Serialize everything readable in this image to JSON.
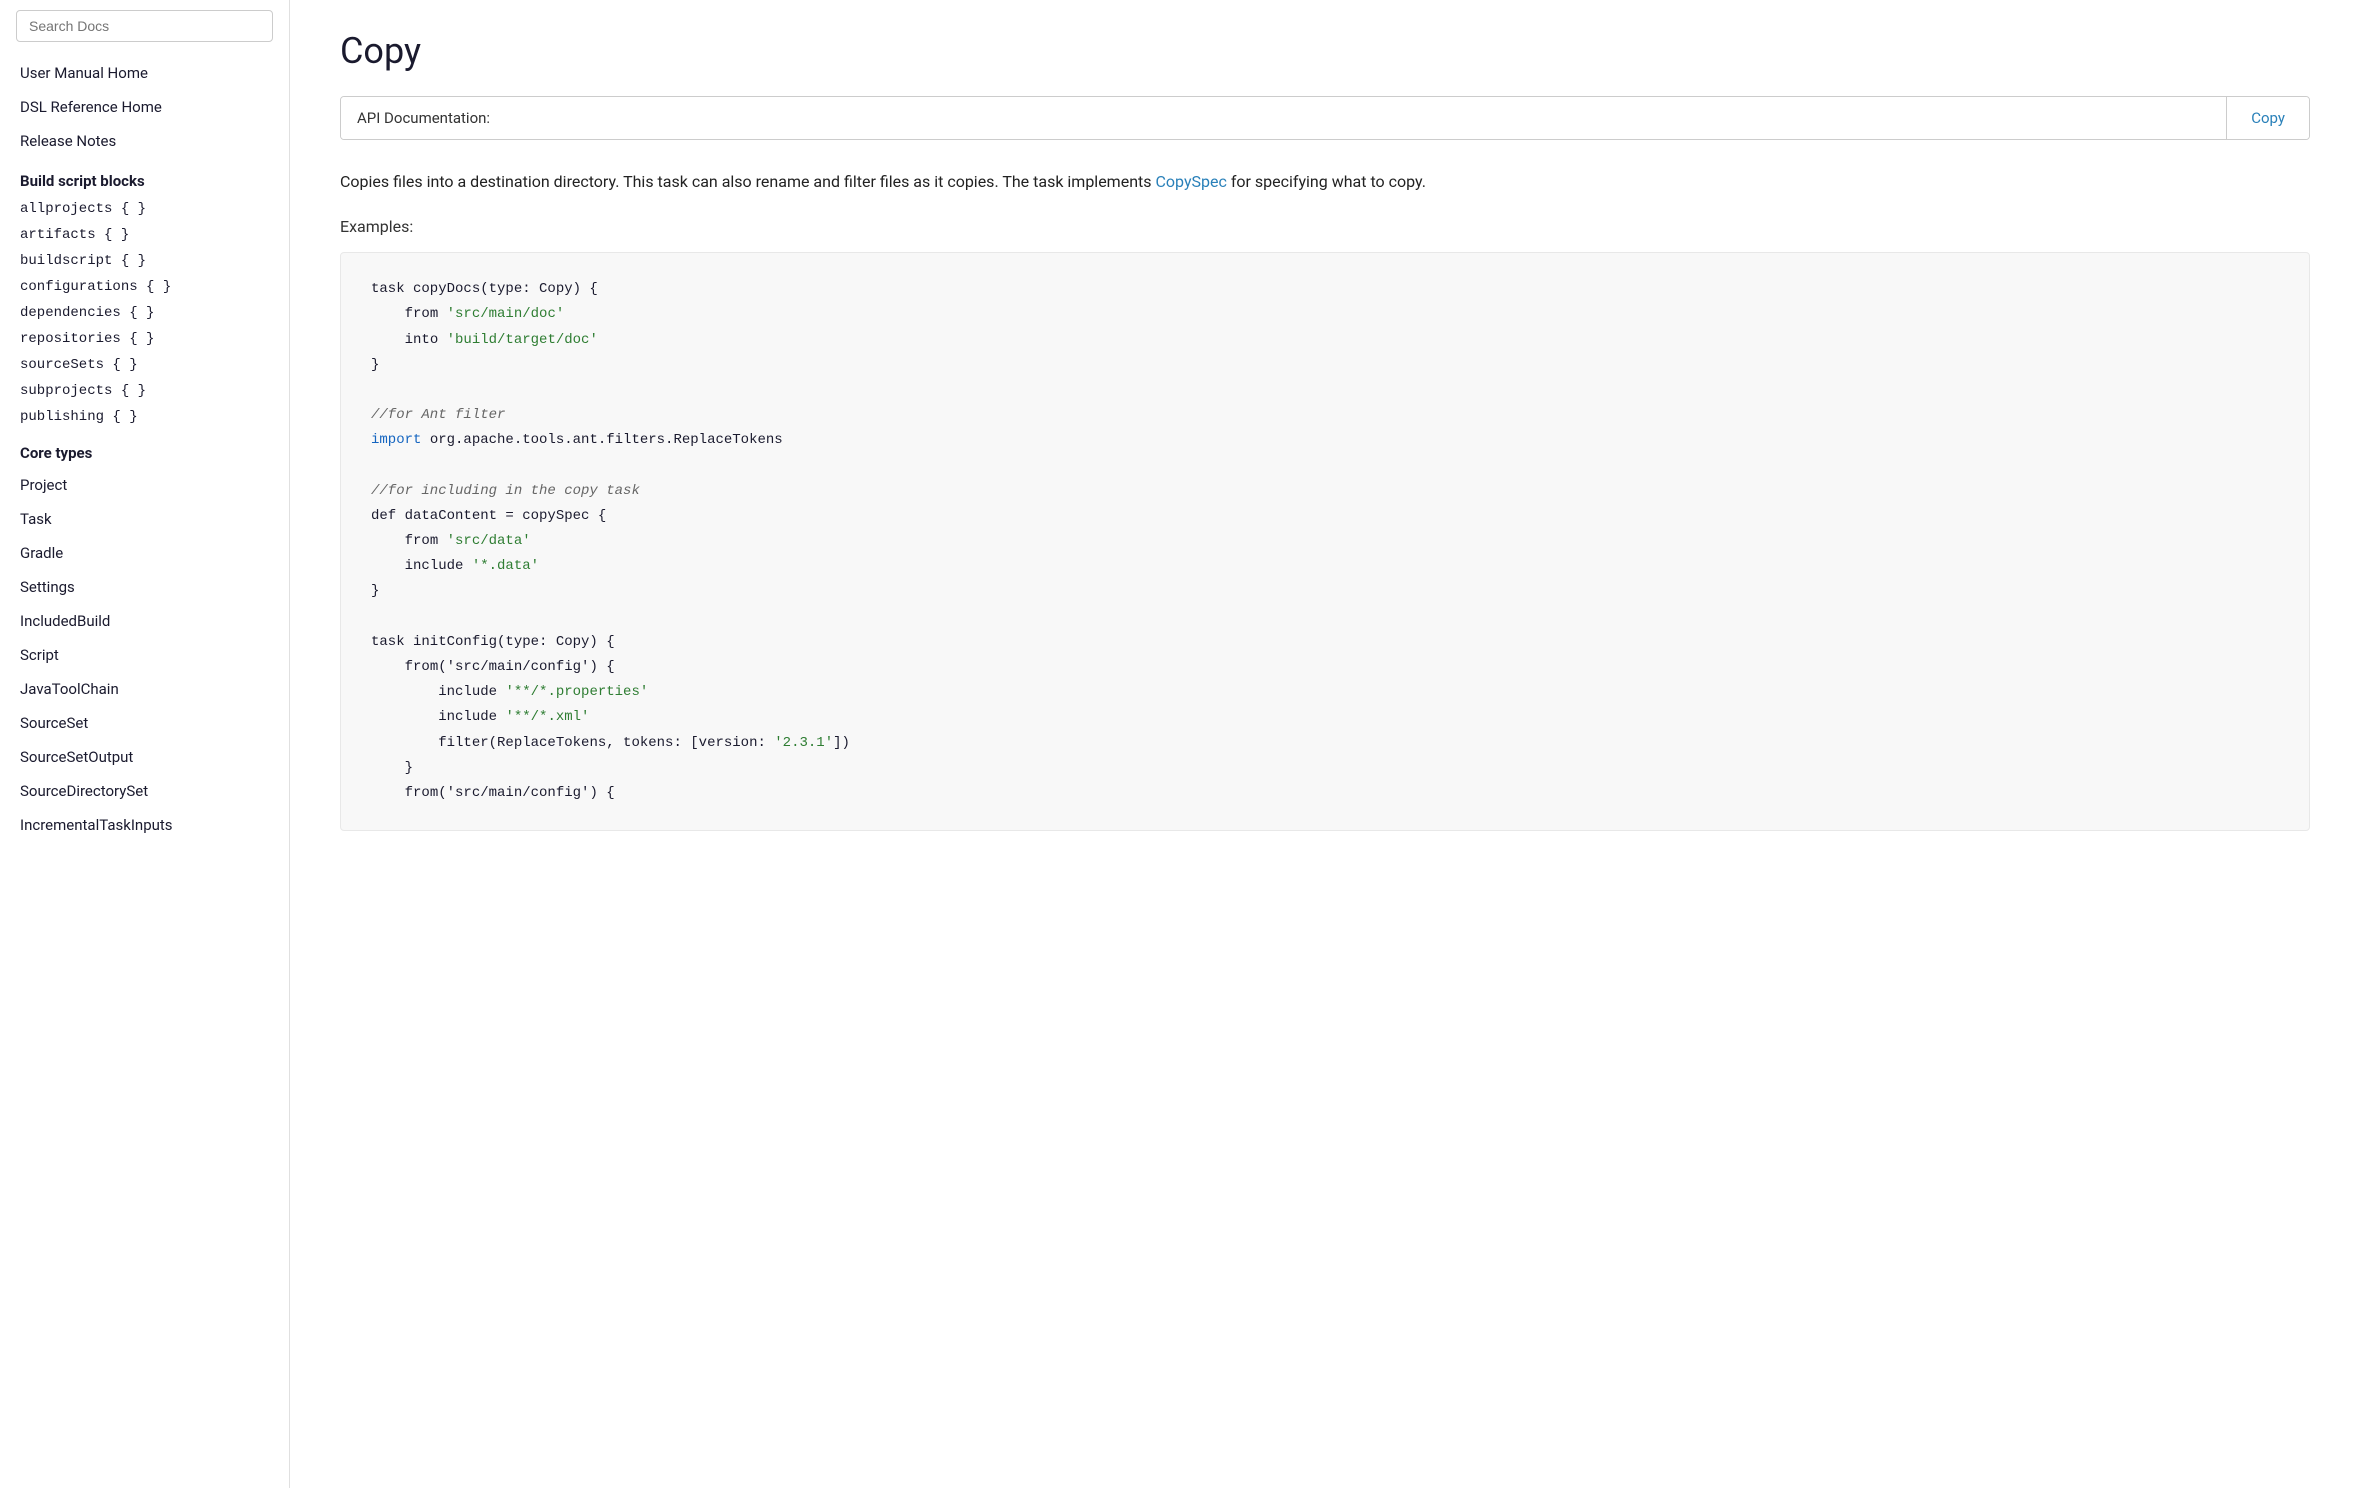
{
  "sidebar": {
    "search_placeholder": "Search Docs",
    "nav_links": [
      {
        "label": "User Manual Home",
        "id": "user-manual-home"
      },
      {
        "label": "DSL Reference Home",
        "id": "dsl-reference-home"
      },
      {
        "label": "Release Notes",
        "id": "release-notes"
      }
    ],
    "build_script_section": {
      "header": "Build script blocks",
      "items": [
        "allprojects { }",
        "artifacts { }",
        "buildscript { }",
        "configurations { }",
        "dependencies { }",
        "repositories { }",
        "sourceSets { }",
        "subprojects { }",
        "publishing { }"
      ]
    },
    "core_types_section": {
      "header": "Core types",
      "items": [
        "Project",
        "Task",
        "Gradle",
        "Settings",
        "IncludedBuild",
        "Script",
        "JavaToolChain",
        "SourceSet",
        "SourceSetOutput",
        "SourceDirectorySet",
        "IncrementalTaskInputs"
      ]
    }
  },
  "main": {
    "page_title": "Copy",
    "api_doc_label": "API Documentation:",
    "api_doc_link": "Copy",
    "description": "Copies files into a destination directory. This task can also rename and filter files as it copies. The task implements",
    "copyspec_link": "CopySpec",
    "description_end": "for specifying what to copy.",
    "examples_heading": "Examples:",
    "code_block": {
      "comment1": "task copyDocs(type: Copy) {",
      "from1": "from",
      "string_from1": "'src/main/doc'",
      "into1": "into",
      "string_into1": "'build/target/doc'",
      "close1": "}",
      "comment_ant": "//for Ant filter",
      "import_line": "import org.apache.tools.ant.filters.ReplaceTokens",
      "comment_copy": "//for including in the copy task",
      "def_line": "def dataContent = copySpec {",
      "from2": "from",
      "string_from2": "'src/data'",
      "include2": "include",
      "string_include2": "'*.data'",
      "close2": "}",
      "task2": "task initConfig(type: Copy) {",
      "from3": "from('src/main/config') {",
      "include3a": "include",
      "string3a": "'**/*.properties'",
      "include3b": "include",
      "string3b": "'**/*.xml'",
      "filter3": "filter(ReplaceTokens, tokens: [version:",
      "string_version": "'2.3.1'",
      "filter3_end": "])",
      "close3": "}",
      "from4": "from('src/main/config') {"
    }
  }
}
